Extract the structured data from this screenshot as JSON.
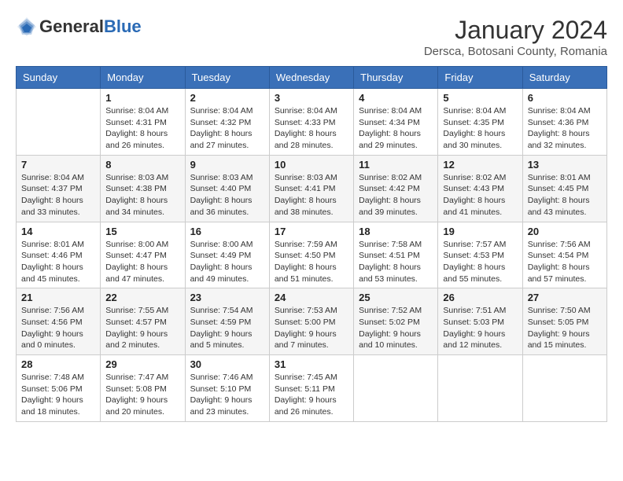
{
  "header": {
    "logo_general": "General",
    "logo_blue": "Blue",
    "month_title": "January 2024",
    "location": "Dersca, Botosani County, Romania"
  },
  "days_of_week": [
    "Sunday",
    "Monday",
    "Tuesday",
    "Wednesday",
    "Thursday",
    "Friday",
    "Saturday"
  ],
  "weeks": [
    [
      {
        "day": "",
        "info": ""
      },
      {
        "day": "1",
        "info": "Sunrise: 8:04 AM\nSunset: 4:31 PM\nDaylight: 8 hours\nand 26 minutes."
      },
      {
        "day": "2",
        "info": "Sunrise: 8:04 AM\nSunset: 4:32 PM\nDaylight: 8 hours\nand 27 minutes."
      },
      {
        "day": "3",
        "info": "Sunrise: 8:04 AM\nSunset: 4:33 PM\nDaylight: 8 hours\nand 28 minutes."
      },
      {
        "day": "4",
        "info": "Sunrise: 8:04 AM\nSunset: 4:34 PM\nDaylight: 8 hours\nand 29 minutes."
      },
      {
        "day": "5",
        "info": "Sunrise: 8:04 AM\nSunset: 4:35 PM\nDaylight: 8 hours\nand 30 minutes."
      },
      {
        "day": "6",
        "info": "Sunrise: 8:04 AM\nSunset: 4:36 PM\nDaylight: 8 hours\nand 32 minutes."
      }
    ],
    [
      {
        "day": "7",
        "info": "Sunrise: 8:04 AM\nSunset: 4:37 PM\nDaylight: 8 hours\nand 33 minutes."
      },
      {
        "day": "8",
        "info": "Sunrise: 8:03 AM\nSunset: 4:38 PM\nDaylight: 8 hours\nand 34 minutes."
      },
      {
        "day": "9",
        "info": "Sunrise: 8:03 AM\nSunset: 4:40 PM\nDaylight: 8 hours\nand 36 minutes."
      },
      {
        "day": "10",
        "info": "Sunrise: 8:03 AM\nSunset: 4:41 PM\nDaylight: 8 hours\nand 38 minutes."
      },
      {
        "day": "11",
        "info": "Sunrise: 8:02 AM\nSunset: 4:42 PM\nDaylight: 8 hours\nand 39 minutes."
      },
      {
        "day": "12",
        "info": "Sunrise: 8:02 AM\nSunset: 4:43 PM\nDaylight: 8 hours\nand 41 minutes."
      },
      {
        "day": "13",
        "info": "Sunrise: 8:01 AM\nSunset: 4:45 PM\nDaylight: 8 hours\nand 43 minutes."
      }
    ],
    [
      {
        "day": "14",
        "info": "Sunrise: 8:01 AM\nSunset: 4:46 PM\nDaylight: 8 hours\nand 45 minutes."
      },
      {
        "day": "15",
        "info": "Sunrise: 8:00 AM\nSunset: 4:47 PM\nDaylight: 8 hours\nand 47 minutes."
      },
      {
        "day": "16",
        "info": "Sunrise: 8:00 AM\nSunset: 4:49 PM\nDaylight: 8 hours\nand 49 minutes."
      },
      {
        "day": "17",
        "info": "Sunrise: 7:59 AM\nSunset: 4:50 PM\nDaylight: 8 hours\nand 51 minutes."
      },
      {
        "day": "18",
        "info": "Sunrise: 7:58 AM\nSunset: 4:51 PM\nDaylight: 8 hours\nand 53 minutes."
      },
      {
        "day": "19",
        "info": "Sunrise: 7:57 AM\nSunset: 4:53 PM\nDaylight: 8 hours\nand 55 minutes."
      },
      {
        "day": "20",
        "info": "Sunrise: 7:56 AM\nSunset: 4:54 PM\nDaylight: 8 hours\nand 57 minutes."
      }
    ],
    [
      {
        "day": "21",
        "info": "Sunrise: 7:56 AM\nSunset: 4:56 PM\nDaylight: 9 hours\nand 0 minutes."
      },
      {
        "day": "22",
        "info": "Sunrise: 7:55 AM\nSunset: 4:57 PM\nDaylight: 9 hours\nand 2 minutes."
      },
      {
        "day": "23",
        "info": "Sunrise: 7:54 AM\nSunset: 4:59 PM\nDaylight: 9 hours\nand 5 minutes."
      },
      {
        "day": "24",
        "info": "Sunrise: 7:53 AM\nSunset: 5:00 PM\nDaylight: 9 hours\nand 7 minutes."
      },
      {
        "day": "25",
        "info": "Sunrise: 7:52 AM\nSunset: 5:02 PM\nDaylight: 9 hours\nand 10 minutes."
      },
      {
        "day": "26",
        "info": "Sunrise: 7:51 AM\nSunset: 5:03 PM\nDaylight: 9 hours\nand 12 minutes."
      },
      {
        "day": "27",
        "info": "Sunrise: 7:50 AM\nSunset: 5:05 PM\nDaylight: 9 hours\nand 15 minutes."
      }
    ],
    [
      {
        "day": "28",
        "info": "Sunrise: 7:48 AM\nSunset: 5:06 PM\nDaylight: 9 hours\nand 18 minutes."
      },
      {
        "day": "29",
        "info": "Sunrise: 7:47 AM\nSunset: 5:08 PM\nDaylight: 9 hours\nand 20 minutes."
      },
      {
        "day": "30",
        "info": "Sunrise: 7:46 AM\nSunset: 5:10 PM\nDaylight: 9 hours\nand 23 minutes."
      },
      {
        "day": "31",
        "info": "Sunrise: 7:45 AM\nSunset: 5:11 PM\nDaylight: 9 hours\nand 26 minutes."
      },
      {
        "day": "",
        "info": ""
      },
      {
        "day": "",
        "info": ""
      },
      {
        "day": "",
        "info": ""
      }
    ]
  ]
}
